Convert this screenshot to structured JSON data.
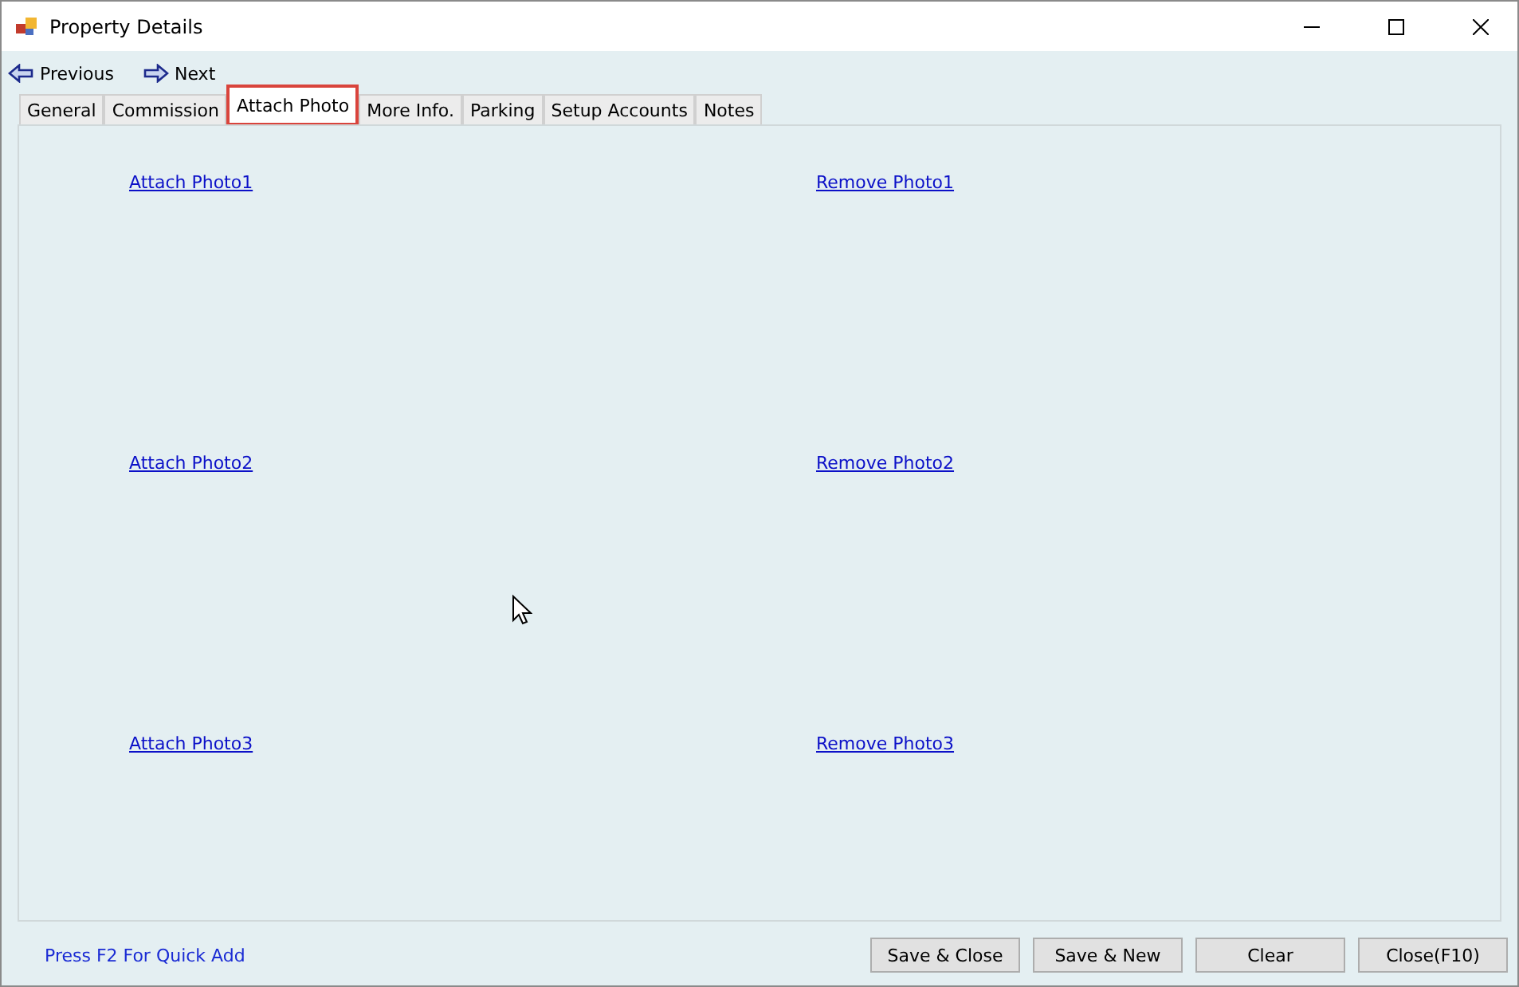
{
  "window": {
    "title": "Property Details"
  },
  "nav": [
    {
      "label": "Previous",
      "kind": "back"
    },
    {
      "label": "Next",
      "kind": "forward"
    }
  ],
  "tabs": [
    {
      "label": "General",
      "selected": false
    },
    {
      "label": "Commission",
      "selected": false
    },
    {
      "label": "Attach Photo",
      "selected": true
    },
    {
      "label": "More Info.",
      "selected": false
    },
    {
      "label": "Parking",
      "selected": false
    },
    {
      "label": "Setup Accounts",
      "selected": false
    },
    {
      "label": "Notes",
      "selected": false
    }
  ],
  "photos": [
    {
      "attach": "Attach Photo1",
      "remove": "Remove Photo1"
    },
    {
      "attach": "Attach Photo2",
      "remove": "Remove Photo2"
    },
    {
      "attach": "Attach Photo3",
      "remove": "Remove Photo3"
    }
  ],
  "hint": "Press F2 For Quick Add",
  "buttons": [
    "Save & Close",
    "Save & New",
    "Clear",
    "Close(F10)"
  ]
}
